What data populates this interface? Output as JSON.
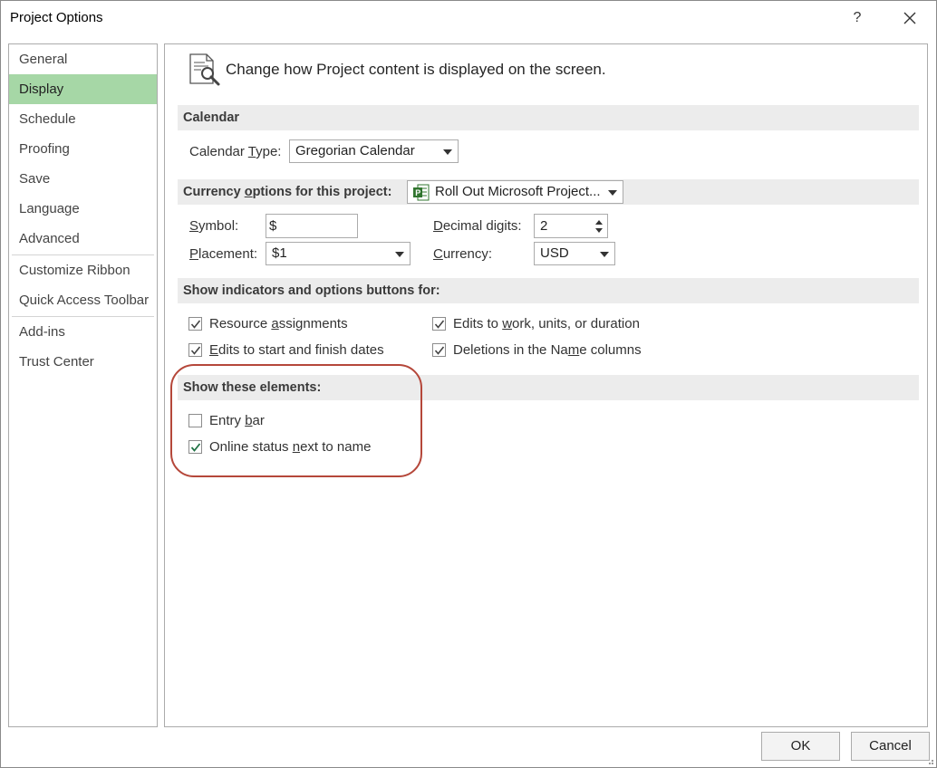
{
  "window": {
    "title": "Project Options",
    "help_label": "?",
    "icons": {
      "help": "question-mark",
      "close": "close-x",
      "header": "page-magnifier-icon",
      "project": "project-file-icon"
    }
  },
  "nav": {
    "items": [
      {
        "label": "General"
      },
      {
        "label": "Display",
        "selected": true
      },
      {
        "label": "Schedule"
      },
      {
        "label": "Proofing"
      },
      {
        "label": "Save"
      },
      {
        "label": "Language"
      },
      {
        "label": "Advanced"
      },
      {
        "label": "Customize Ribbon"
      },
      {
        "label": "Quick Access Toolbar"
      },
      {
        "label": "Add-ins"
      },
      {
        "label": "Trust Center"
      }
    ]
  },
  "header": {
    "text": "Change how Project content is displayed on the screen."
  },
  "calendar": {
    "section_title": "Calendar",
    "type_label_pre": "Calendar ",
    "type_label_u": "T",
    "type_label_post": "ype:",
    "type_value": "Gregorian Calendar"
  },
  "currency": {
    "section_pre": "Currency ",
    "section_u": "o",
    "section_post": "ptions for this project:",
    "project_value": "Roll Out Microsoft Project...",
    "symbol_u": "S",
    "symbol_post": "ymbol:",
    "symbol_value": "$",
    "decimal_u": "D",
    "decimal_post": "ecimal digits:",
    "decimal_value": "2",
    "placement_u": "P",
    "placement_post": "lacement:",
    "placement_value": "$1",
    "currency_u": "C",
    "currency_post": "urrency:",
    "currency_value": "USD"
  },
  "indicators": {
    "section_title": "Show indicators and options buttons for:",
    "items": [
      {
        "pre": "Resource ",
        "u": "a",
        "post": "ssignments",
        "checked": true
      },
      {
        "pre": "",
        "u": "E",
        "post": "dits to start and finish dates",
        "checked": true
      },
      {
        "pre": "Edits to ",
        "u": "w",
        "post": "ork, units, or duration",
        "checked": true
      },
      {
        "pre": "Deletions in the Na",
        "u": "m",
        "post": "e columns",
        "checked": true
      }
    ]
  },
  "elements": {
    "section_title": "Show these elements:",
    "items": [
      {
        "pre": "Entry ",
        "u": "b",
        "post": "ar",
        "checked": false
      },
      {
        "pre": "Online status ",
        "u": "n",
        "post": "ext to name",
        "checked": true
      }
    ],
    "highlight_color": "#b5473a"
  },
  "footer": {
    "ok_label": "OK",
    "cancel_label": "Cancel"
  },
  "colors": {
    "nav_selected": "#a6d7a6",
    "section_bg": "#ececec",
    "check_green": "#217346"
  }
}
